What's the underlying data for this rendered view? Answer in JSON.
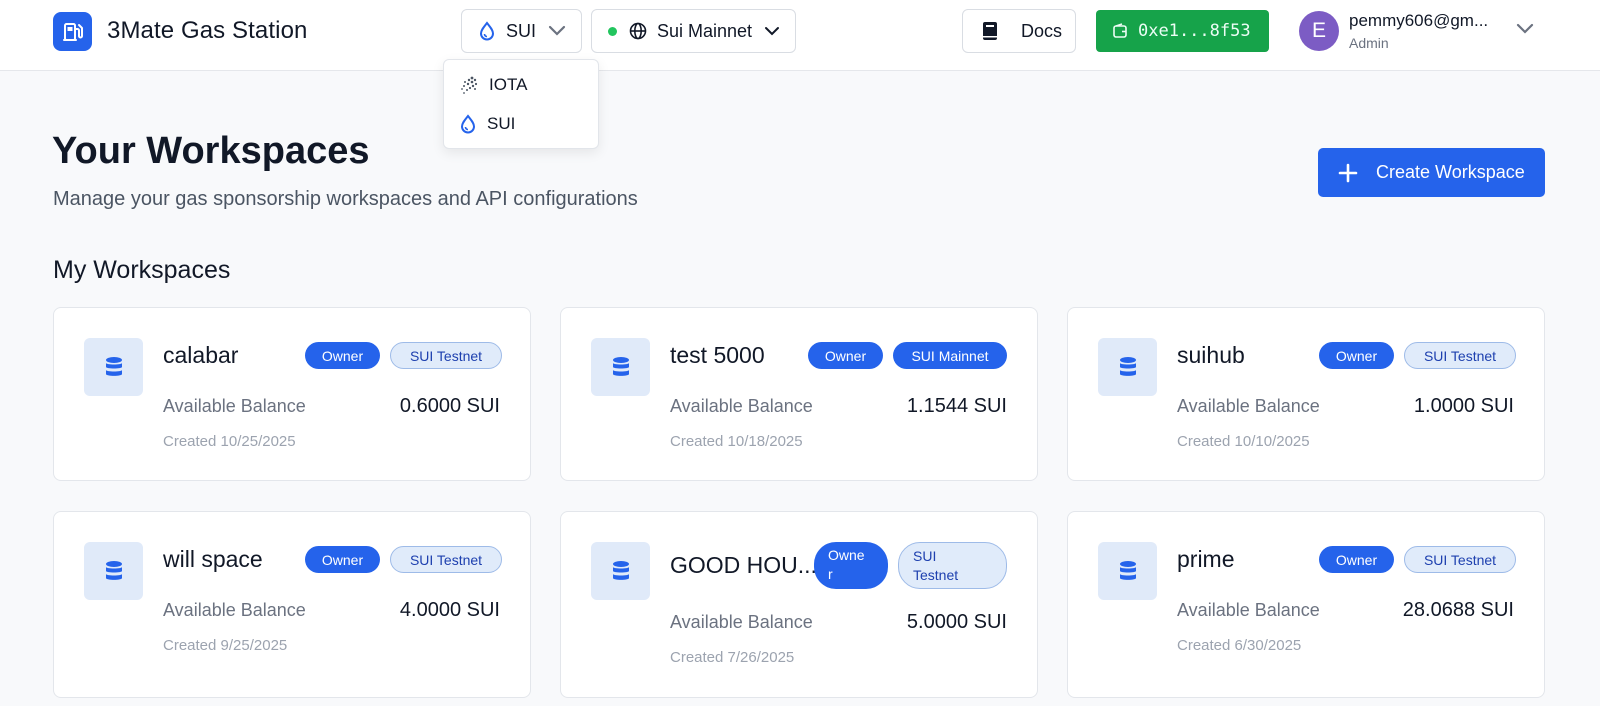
{
  "header": {
    "app_title": "3Mate Gas Station",
    "chain_select": {
      "value": "SUI",
      "icon": "droplet-icon"
    },
    "network_select": {
      "value": "Sui Mainnet",
      "status_color": "#22c55e",
      "icon": "globe-icon"
    },
    "docs_label": "Docs",
    "wallet_address": "0xe1...8f53",
    "user": {
      "initial": "E",
      "email": "pemmy606@gm...",
      "role": "Admin"
    }
  },
  "chain_dropdown": {
    "items": [
      {
        "label": "IOTA",
        "icon": "iota-icon"
      },
      {
        "label": "SUI",
        "icon": "droplet-icon"
      }
    ]
  },
  "main": {
    "title": "Your Workspaces",
    "subtitle": "Manage your gas sponsorship workspaces and API configurations",
    "create_label": "Create Workspace",
    "section_title": "My Workspaces"
  },
  "workspaces": [
    {
      "name": "calabar",
      "role": "Owner",
      "network": "SUI Testnet",
      "balance_label": "Available Balance",
      "balance": "0.6000 SUI",
      "created": "Created 10/25/2025"
    },
    {
      "name": "test 5000",
      "role": "Owner",
      "network": "SUI Mainnet",
      "balance_label": "Available Balance",
      "balance": "1.1544 SUI",
      "created": "Created 10/18/2025"
    },
    {
      "name": "suihub",
      "role": "Owner",
      "network": "SUI Testnet",
      "balance_label": "Available Balance",
      "balance": "1.0000 SUI",
      "created": "Created 10/10/2025"
    },
    {
      "name": "will space",
      "role": "Owner",
      "network": "SUI Testnet",
      "balance_label": "Available Balance",
      "balance": "4.0000 SUI",
      "created": "Created 9/25/2025"
    },
    {
      "name": "GOOD HOU...",
      "role": "Owne\nr",
      "network": "SUI\nTestnet",
      "balance_label": "Available Balance",
      "balance": "5.0000 SUI",
      "created": "Created 7/26/2025"
    },
    {
      "name": "prime",
      "role": "Owner",
      "network": "SUI Testnet",
      "balance_label": "Available Balance",
      "balance": "28.0688 SUI",
      "created": "Created 6/30/2025"
    }
  ],
  "colors": {
    "accent": "#2563eb",
    "wallet": "#16a34a",
    "avatar": "#7c5cc4"
  }
}
